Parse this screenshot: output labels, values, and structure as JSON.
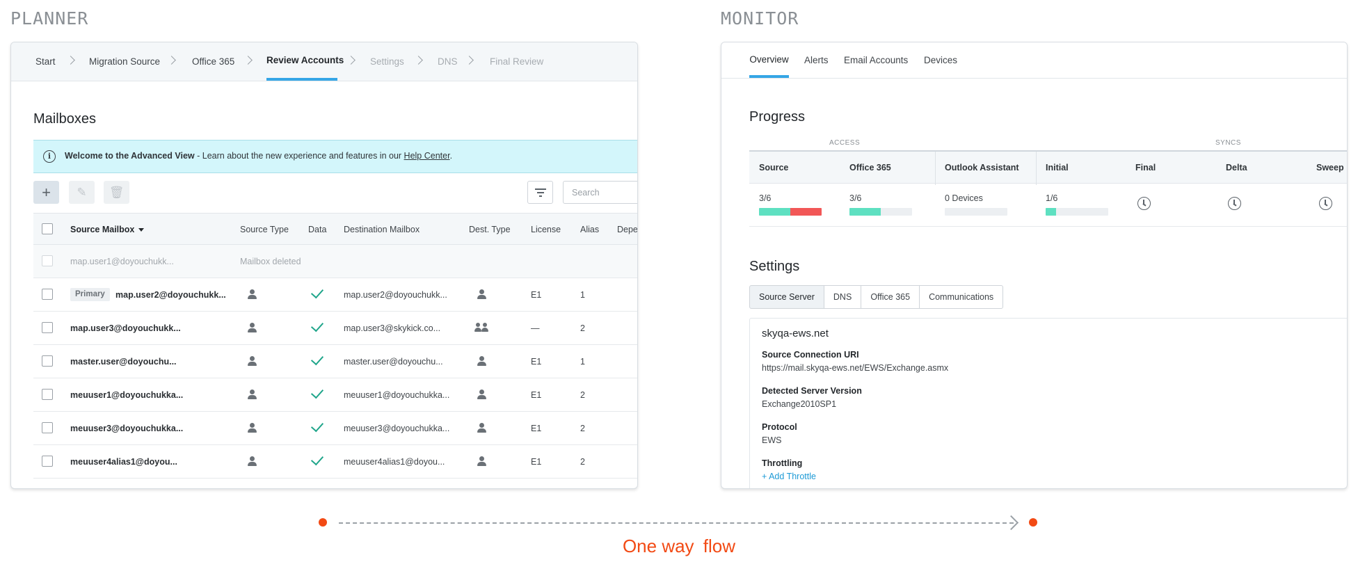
{
  "sections": {
    "planner": "PLANNER",
    "monitor": "MONITOR"
  },
  "planner": {
    "steps": [
      "Start",
      "Migration Source",
      "Office 365",
      "Review Accounts",
      "Settings",
      "DNS",
      "Final Review"
    ],
    "active_step": "Review Accounts",
    "title": "Mailboxes",
    "banner": {
      "bold": "Welcome to the Advanced View",
      "text": " - Learn about the new experience and features in our ",
      "link": "Help Center",
      "end": "."
    },
    "search_placeholder": "Search",
    "columns": [
      "Source Mailbox",
      "Source Type",
      "Data",
      "Destination Mailbox",
      "Dest. Type",
      "License",
      "Alias",
      "Depe"
    ],
    "rows": [
      {
        "source": "map.user1@doyouchukk...",
        "status": "Mailbox deleted",
        "deleted": true
      },
      {
        "badge": "Primary",
        "source": "map.user2@doyouchukk...",
        "dest": "map.user2@doyouchukk...",
        "dest_type": "user",
        "license": "E1",
        "alias": "1"
      },
      {
        "source": "map.user3@doyouchukk...",
        "dest": "map.user3@skykick.co...",
        "dest_type": "group",
        "license": "—",
        "alias": "2"
      },
      {
        "source": "master.user@doyouchu...",
        "dest": "master.user@doyouchu...",
        "dest_type": "user",
        "license": "E1",
        "alias": "1"
      },
      {
        "source": "meuuser1@doyouchukka...",
        "dest": "meuuser1@doyouchukka...",
        "dest_type": "user",
        "license": "E1",
        "alias": "2"
      },
      {
        "source": "meuuser3@doyouchukka...",
        "dest": "meuuser3@doyouchukka...",
        "dest_type": "user",
        "license": "E1",
        "alias": "2"
      },
      {
        "source": "meuuser4alias1@doyou...",
        "dest": "meuuser4alias1@doyou...",
        "dest_type": "user",
        "license": "E1",
        "alias": "2"
      }
    ]
  },
  "monitor": {
    "tabs": [
      "Overview",
      "Alerts",
      "Email Accounts",
      "Devices"
    ],
    "active_tab": "Overview",
    "progress": {
      "title": "Progress",
      "group_access": "ACCESS",
      "group_syncs": "SYNCS",
      "columns": [
        "Source",
        "Office 365",
        "Outlook Assistant",
        "Initial",
        "Final",
        "Delta",
        "Sweep"
      ],
      "source": {
        "text": "3/6",
        "ok": 0.5,
        "error": 0.5
      },
      "office365": {
        "text": "3/6",
        "ok": 0.5
      },
      "outlook": {
        "text": "0 Devices",
        "ok": 0
      },
      "initial": {
        "text": "1/6",
        "ok": 0.1667
      }
    },
    "settings": {
      "title": "Settings",
      "tabs": [
        "Source Server",
        "DNS",
        "Office 365",
        "Communications"
      ],
      "active_tab": "Source Server",
      "host": "skyqa-ews.net",
      "fields": [
        {
          "label": "Source Connection URI",
          "value": "https://mail.skyqa-ews.net/EWS/Exchange.asmx"
        },
        {
          "label": "Detected Server Version",
          "value": "Exchange2010SP1"
        },
        {
          "label": "Protocol",
          "value": "EWS"
        },
        {
          "label": "Throttling",
          "link": "+ Add Throttle"
        }
      ]
    }
  },
  "flow": {
    "label_a": "One way",
    "label_b": "flow",
    "color": "#f24a14"
  },
  "colors": {
    "accent": "#35a6e6",
    "success": "#1fa58a",
    "bar_ok": "#5ee0c1",
    "bar_error": "#f25757",
    "link": "#1d9ad6"
  }
}
